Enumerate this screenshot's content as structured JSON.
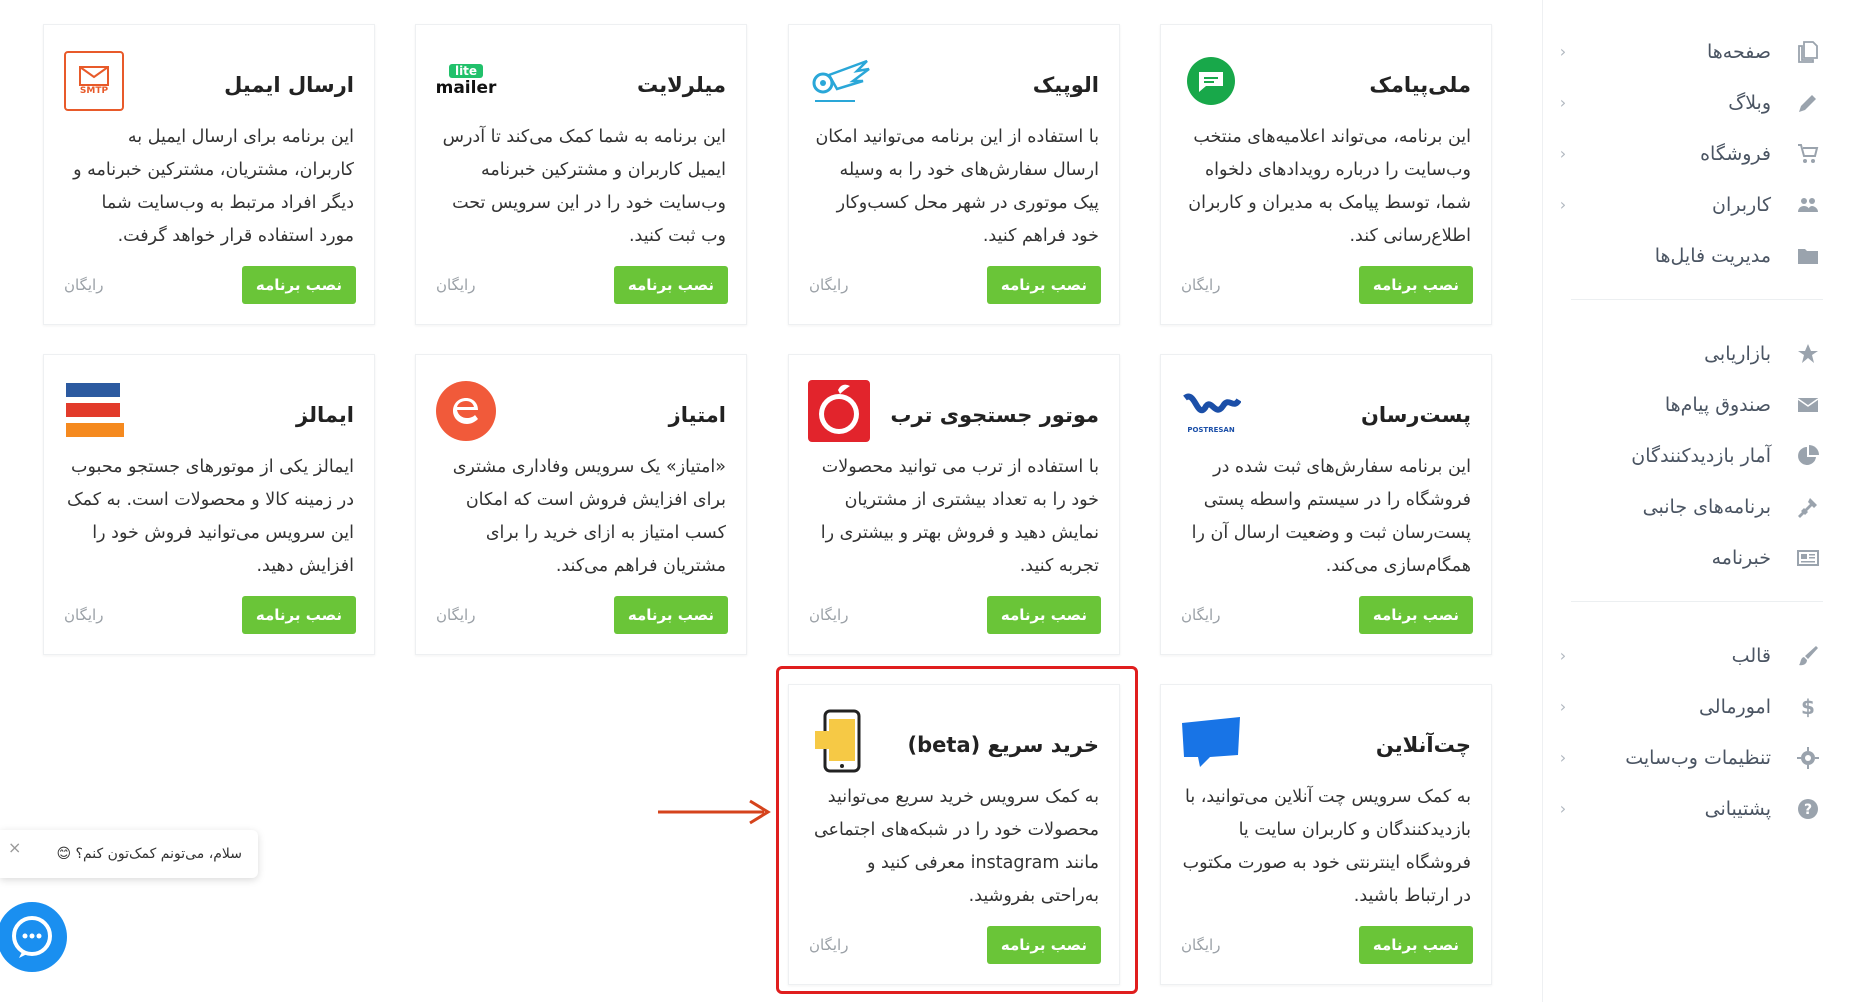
{
  "sidebar": {
    "group1": [
      {
        "label": "صفحه‌ها",
        "icon": "pages-icon",
        "chevron": true
      },
      {
        "label": "وبلاگ",
        "icon": "pencil-icon",
        "chevron": true
      },
      {
        "label": "فروشگاه",
        "icon": "cart-icon",
        "chevron": true
      },
      {
        "label": "کاربران",
        "icon": "users-icon",
        "chevron": true
      },
      {
        "label": "مدیریت فایل‌ها",
        "icon": "folder-icon",
        "chevron": false
      }
    ],
    "group2": [
      {
        "label": "بازاریابی",
        "icon": "star-icon"
      },
      {
        "label": "صندوق پیام‌ها",
        "icon": "envelope-icon"
      },
      {
        "label": "آمار بازدیدکنندگان",
        "icon": "pie-chart-icon"
      },
      {
        "label": "برنامه‌های جانبی",
        "icon": "plug-icon"
      },
      {
        "label": "خبرنامه",
        "icon": "newspaper-icon"
      }
    ],
    "group3": [
      {
        "label": "قالب",
        "icon": "brush-icon"
      },
      {
        "label": "امورمالی",
        "icon": "dollar-icon"
      },
      {
        "label": "تنظیمات وب‌سایت",
        "icon": "gear-icon"
      },
      {
        "label": "پشتیبانی",
        "icon": "help-icon"
      }
    ]
  },
  "cards": [
    {
      "title": "ملی‌پیامک",
      "logo": "melipayamak-logo",
      "desc": "این برنامه، می‌تواند اعلامیه‌های منتخب وب‌سایت را درباره رویدادهای دلخواه شما، توسط پیامک به مدیران و کاربران اطلاع‌رسانی کند.",
      "button": "نصب برنامه",
      "price": "رایگان"
    },
    {
      "title": "الوپیک",
      "logo": "alopeyk-logo",
      "desc": "با استفاده از این برنامه می‌توانید امکان ارسال سفارش‌های خود را به وسیله پیک موتوری در شهر محل کسب‌وکار خود فراهم کنید.",
      "button": "نصب برنامه",
      "price": "رایگان"
    },
    {
      "title": "میلرلایت",
      "logo": "mailerlite-logo",
      "logo_text_top": "lite",
      "logo_text_bottom": "mailer",
      "desc": "این برنامه به شما کمک می‌کند تا آدرس ایمیل کاربران و مشترکین خبرنامه وب‌سایت خود را در این سرویس تحت وب ثبت کنید.",
      "button": "نصب برنامه",
      "price": "رایگان"
    },
    {
      "title": "ارسال ایمیل",
      "logo": "smtp-logo",
      "logo_text": "SMTP",
      "desc": "این برنامه برای ارسال ایمیل به کاربران، مشتریان، مشترکین خبرنامه و دیگر افراد مرتبط به وب‌سایت شما مورد استفاده قرار خواهد گرفت.",
      "button": "نصب برنامه",
      "price": "رایگان"
    },
    {
      "title": "پست‌رسان",
      "logo": "postresan-logo",
      "logo_text": "POSTRESAN",
      "desc": "این برنامه سفارش‌های ثبت شده در فروشگاه را در سیستم واسطه پستی پست‌رسان ثبت و وضعیت ارسال آن را همگام‌سازی می‌کند.",
      "button": "نصب برنامه",
      "price": "رایگان"
    },
    {
      "title": "موتور جستجوی ترب",
      "logo": "torob-logo",
      "desc": "با استفاده از ترب می توانید محصولات خود را به تعداد بیشتری از مشتریان نمایش دهید و فروش بهتر و بیشتری را تجربه کنید.",
      "button": "نصب برنامه",
      "price": "رایگان"
    },
    {
      "title": "امتیاز",
      "logo": "emtiyaz-logo",
      "desc": "«امتیاز» یک سرویس وفاداری مشتری برای افزایش فروش است که امکان کسب امتیاز به ازای خرید را برای مشتریان فراهم می‌کند.",
      "button": "نصب برنامه",
      "price": "رایگان"
    },
    {
      "title": "ایمالز",
      "logo": "emalls-logo",
      "desc": "ایمالز یکی از موتورهای جستجو محبوب در زمینه کالا و محصولات است. به کمک این سرویس می‌توانید فروش خود را افزایش دهید.",
      "button": "نصب برنامه",
      "price": "رایگان"
    },
    {
      "title": "چت‌آنلاین",
      "logo": "chat-online-logo",
      "desc": "به کمک سرویس چت آنلاین می‌توانید، با بازدیدکنندگان و کاربران سایت یا فروشگاه اینترنتی خود به صورت مکتوب در ارتباط باشید.",
      "button": "نصب برنامه",
      "price": "رایگان"
    },
    {
      "title": "خرید سریع (beta)",
      "logo": "quick-buy-logo",
      "desc": "به کمک سرویس خرید سریع می‌توانید محصولات خود را در شبکه‌های اجتماعی مانند instagram معرفی کنید و به‌راحتی بفروشید.",
      "button": "نصب برنامه",
      "price": "رایگان"
    }
  ],
  "chat_widget": {
    "message": "سلام، می‌تونم کمک‌تون کنم؟ 😊"
  },
  "colors": {
    "install_button": "#6ac538",
    "highlight": "#e01e1e",
    "chat": "#1a8ff0"
  }
}
